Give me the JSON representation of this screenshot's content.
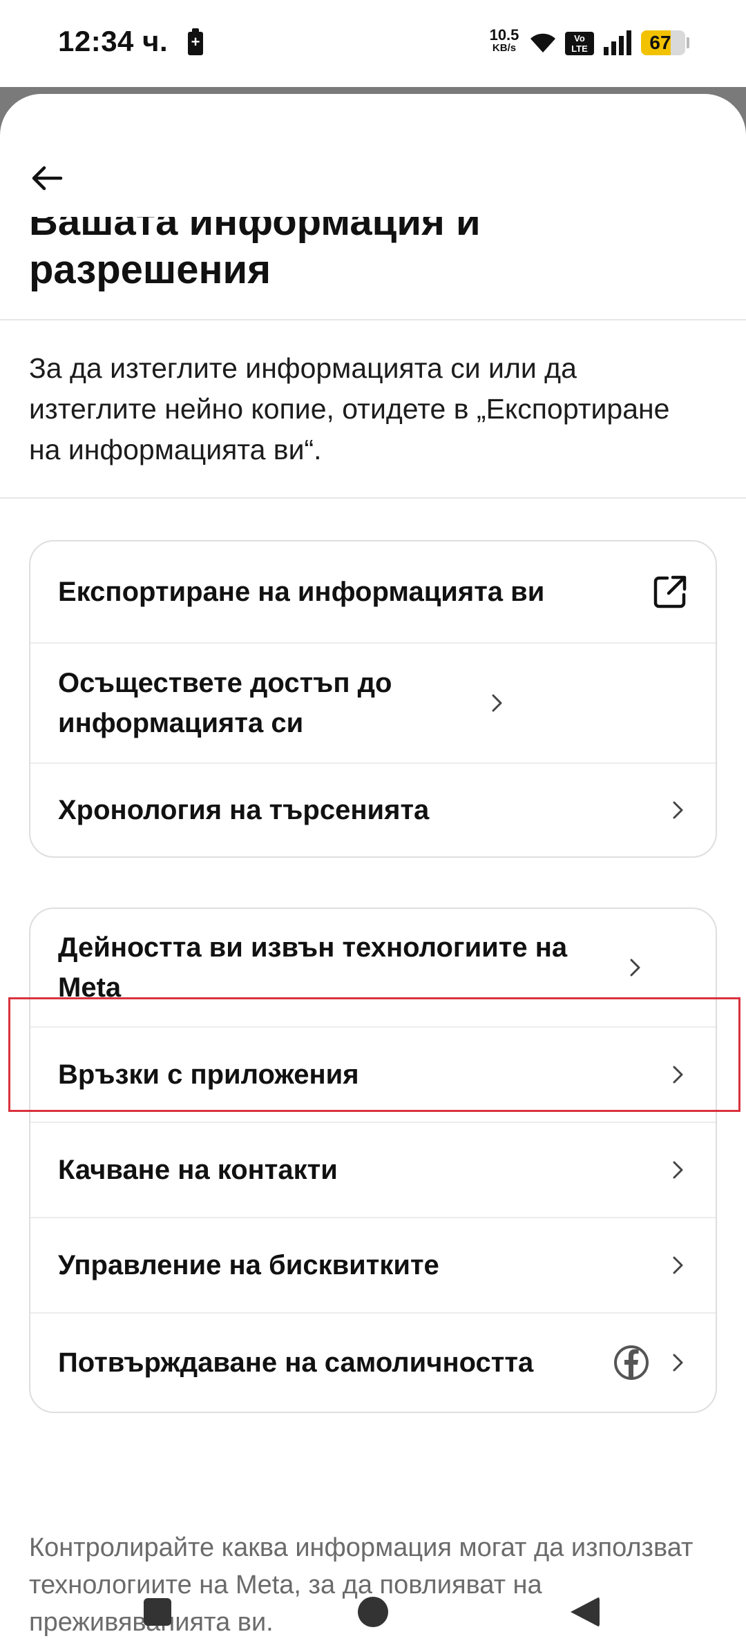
{
  "status_bar": {
    "time": "12:34 ч.",
    "net_speed_value": "10.5",
    "net_speed_unit": "KB/s",
    "volte_label": "Vo\nLTE",
    "battery_level": "67",
    "battery_fraction": 0.67,
    "battery_color": "#f2c200"
  },
  "header": {
    "back_icon": "arrow-left-icon",
    "title": "Вашата информация и разрешения"
  },
  "description": "За да изтеглите информацията си или да изтеглите нейно копие, отидете в „Експортиране на информацията ви“.",
  "card1": {
    "items": [
      {
        "label": "Експортиране на информацията ви",
        "icon": "external-link-icon"
      },
      {
        "label": "Осъществете достъп до информацията си",
        "icon": "chevron-right-icon"
      },
      {
        "label": "Хронология на търсенията",
        "icon": "chevron-right-icon"
      }
    ]
  },
  "card2": {
    "items": [
      {
        "label": "Дейността ви извън технологиите на Meta",
        "icon": "chevron-right-icon"
      },
      {
        "label": "Връзки с приложения",
        "icon": "chevron-right-icon"
      },
      {
        "label": "Качване на контакти",
        "icon": "chevron-right-icon"
      },
      {
        "label": "Управление на бисквитките",
        "icon": "chevron-right-icon"
      },
      {
        "label": "Потвърждаване на самоличността",
        "icon": "chevron-right-icon",
        "extra_icon": "facebook-icon"
      }
    ]
  },
  "footer_note": "Контролирайте каква информация могат да използват технологиите на Meta, за да повлияват на преживяванията ви.",
  "highlight_color": "#d9323e"
}
